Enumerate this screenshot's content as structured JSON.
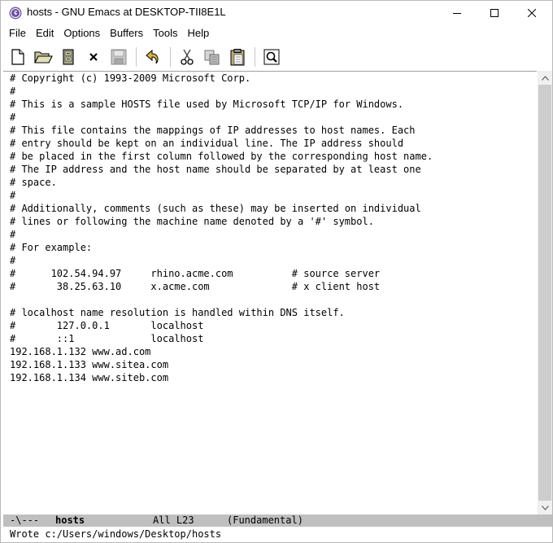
{
  "window": {
    "title": "hosts - GNU Emacs at DESKTOP-TII8E1L",
    "app_icon": "emacs-icon",
    "controls": [
      "minimize-icon",
      "maximize-icon",
      "close-icon"
    ]
  },
  "menu": {
    "items": [
      "File",
      "Edit",
      "Options",
      "Buffers",
      "Tools",
      "Help"
    ]
  },
  "toolbar": {
    "buttons": [
      {
        "name": "new-file-icon"
      },
      {
        "name": "open-folder-icon"
      },
      {
        "name": "dired-icon"
      },
      {
        "name": "close-buffer-icon"
      },
      {
        "name": "save-icon"
      },
      {
        "name": "undo-icon"
      },
      {
        "name": "cut-icon"
      },
      {
        "name": "copy-icon"
      },
      {
        "name": "paste-icon"
      },
      {
        "name": "search-icon"
      }
    ]
  },
  "buffer": {
    "lines": [
      "# Copyright (c) 1993-2009 Microsoft Corp.",
      "#",
      "# This is a sample HOSTS file used by Microsoft TCP/IP for Windows.",
      "#",
      "# This file contains the mappings of IP addresses to host names. Each",
      "# entry should be kept on an individual line. The IP address should",
      "# be placed in the first column followed by the corresponding host name.",
      "# The IP address and the host name should be separated by at least one",
      "# space.",
      "#",
      "# Additionally, comments (such as these) may be inserted on individual",
      "# lines or following the machine name denoted by a '#' symbol.",
      "#",
      "# For example:",
      "#",
      "#      102.54.94.97     rhino.acme.com          # source server",
      "#       38.25.63.10     x.acme.com              # x client host",
      "",
      "# localhost name resolution is handled within DNS itself.",
      "#       127.0.0.1       localhost",
      "#       ::1             localhost",
      "192.168.1.132 www.ad.com",
      "192.168.1.133 www.sitea.com",
      "192.168.1.134 www.siteb.com"
    ]
  },
  "modeline": {
    "status": "-\\---",
    "buffer_name": "hosts",
    "position": "All L23",
    "mode": "(Fundamental)"
  },
  "echo_area": {
    "message": "Wrote c:/Users/windows/Desktop/hosts"
  }
}
